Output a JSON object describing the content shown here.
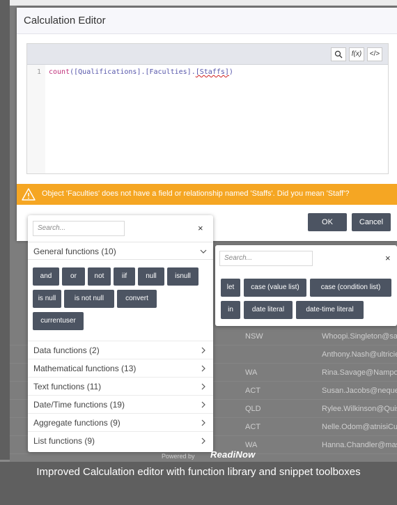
{
  "dialog": {
    "title": "Calculation Editor",
    "toolbar": {
      "search_icon": "search-icon",
      "fx_label": "f(x)",
      "code_label": "</>"
    },
    "line_number": "1",
    "code": {
      "keyword": "count",
      "open": "([Qualifications].[Faculties].",
      "error_token": "[Staffs]",
      "close": ")"
    },
    "warning": "Object 'Faculties' does not have a field or relationship named 'Staffs'. Did you mean 'Staff'?",
    "ok_label": "OK",
    "cancel_label": "Cancel"
  },
  "function_library": {
    "search_placeholder": "Search...",
    "close": "×",
    "general": {
      "label": "General functions (10)",
      "chips": [
        "and",
        "or",
        "not",
        "iif",
        "null",
        "isnull",
        "is null",
        "is not null",
        "convert",
        "currentuser"
      ]
    },
    "categories": [
      "Data functions (2)",
      "Mathematical functions (13)",
      "Text functions (11)",
      "Date/Time functions (19)",
      "Aggregate functions (9)",
      "List functions (9)"
    ]
  },
  "snippets": {
    "search_placeholder": "Search...",
    "close": "×",
    "chips": [
      "let",
      "case (value list)",
      "case (condition list)",
      "in",
      "date literal",
      "date-time literal"
    ]
  },
  "background_table": {
    "rows": [
      {
        "state": "NSW",
        "email": "Whoopi.Singleton@sap"
      },
      {
        "state": "",
        "email": "Anthony.Nash@ultricie"
      },
      {
        "state": "WA",
        "email": "Rina.Savage@Namport"
      },
      {
        "state": "ACT",
        "email": "Susan.Jacobs@nequee"
      },
      {
        "state": "QLD",
        "email": "Rylee.Wilkinson@Quisc"
      },
      {
        "state": "ACT",
        "email": "Nelle.Odom@atnisiCur"
      },
      {
        "state": "WA",
        "email": "Hanna.Chandler@mass"
      }
    ]
  },
  "footer": {
    "powered_by": "Powered by",
    "brand": "ReadiNow",
    "caption": "Improved Calculation editor with function library and snippet toolboxes"
  },
  "colors": {
    "warning": "#f5a623",
    "chip": "#4c5462",
    "error_underline": "#d02020"
  }
}
